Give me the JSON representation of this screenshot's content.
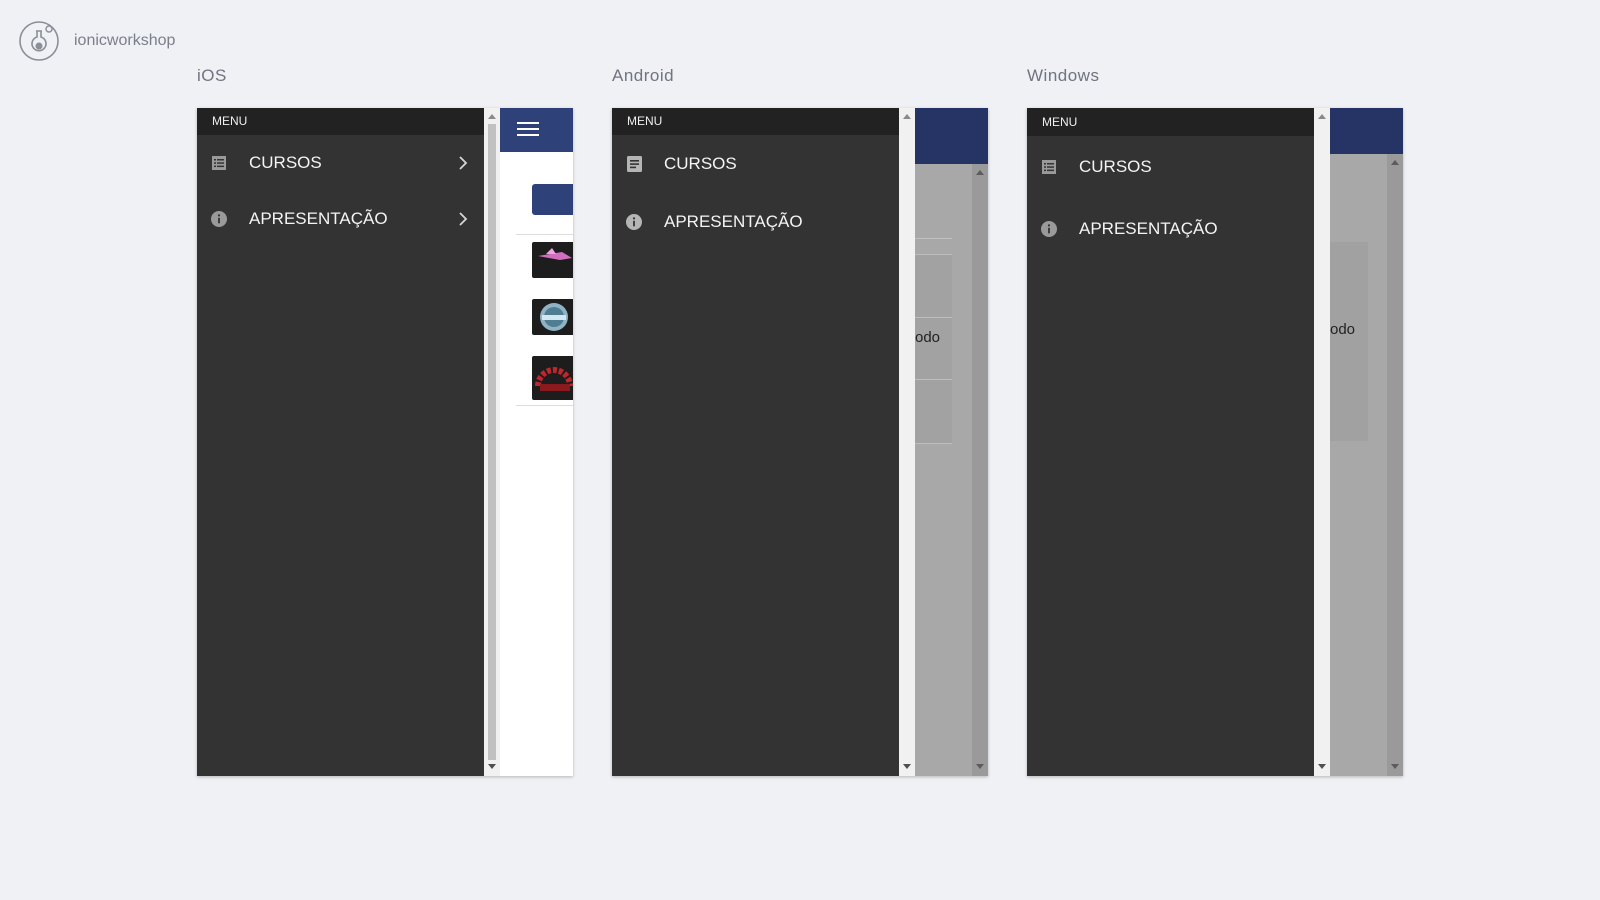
{
  "brand": {
    "name": "ionicworkshop",
    "icon": "flask-icon"
  },
  "platforms": [
    {
      "title": "iOS",
      "menu_header": "MENU",
      "items": [
        {
          "label": "CURSOS",
          "icon": "list-icon"
        },
        {
          "label": "APRESENTAÇÃO",
          "icon": "info-icon"
        }
      ]
    },
    {
      "title": "Android",
      "menu_header": "MENU",
      "items": [
        {
          "label": "CURSOS",
          "icon": "list-icon"
        },
        {
          "label": "APRESENTAÇÃO",
          "icon": "info-icon"
        }
      ],
      "peek_text": "odo"
    },
    {
      "title": "Windows",
      "menu_header": "MENU",
      "items": [
        {
          "label": "CURSOS",
          "icon": "list-icon"
        },
        {
          "label": "APRESENTAÇÃO",
          "icon": "info-icon"
        }
      ],
      "peek_text": "odo"
    }
  ],
  "colors": {
    "background": "#eff1f5",
    "menu": "#333333",
    "menu_header": "#222222",
    "toolbar": "#2e4279"
  }
}
